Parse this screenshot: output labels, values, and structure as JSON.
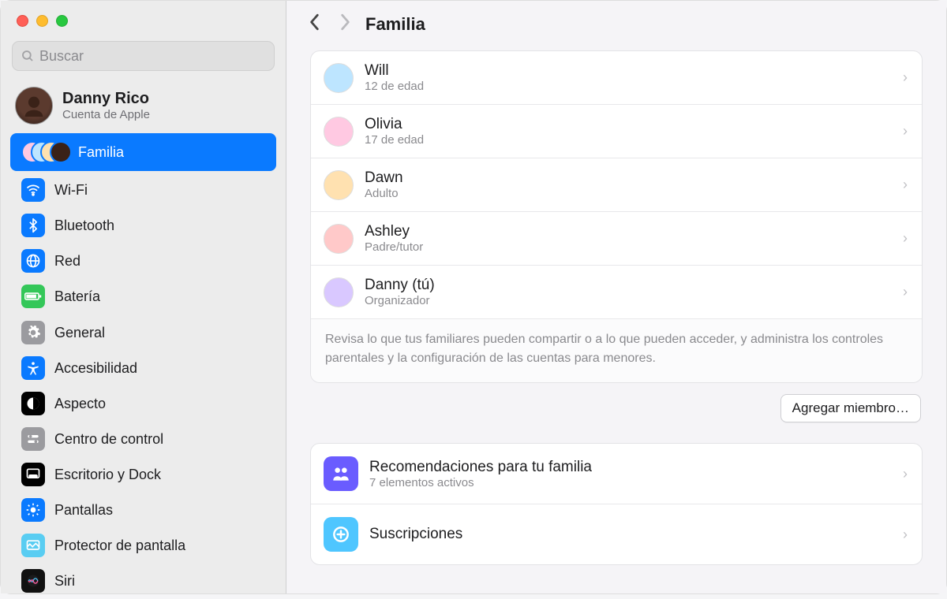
{
  "search": {
    "placeholder": "Buscar"
  },
  "account": {
    "name": "Danny Rico",
    "sub": "Cuenta de Apple"
  },
  "sidebar": {
    "active": {
      "label": "Familia"
    },
    "group1": [
      {
        "label": "Wi-Fi",
        "bg": "#0a7aff",
        "icon": "wifi"
      },
      {
        "label": "Bluetooth",
        "bg": "#0a7aff",
        "icon": "bt"
      },
      {
        "label": "Red",
        "bg": "#0a7aff",
        "icon": "globe"
      },
      {
        "label": "Batería",
        "bg": "#34c759",
        "icon": "batt"
      }
    ],
    "group2": [
      {
        "label": "General",
        "bg": "#9b9b9f",
        "icon": "gear"
      },
      {
        "label": "Accesibilidad",
        "bg": "#0a7aff",
        "icon": "acc"
      },
      {
        "label": "Aspecto",
        "bg": "#000",
        "icon": "appear"
      },
      {
        "label": "Centro de control",
        "bg": "#9b9b9f",
        "icon": "cc"
      },
      {
        "label": "Escritorio y Dock",
        "bg": "#000",
        "icon": "dock"
      },
      {
        "label": "Pantallas",
        "bg": "#0a7aff",
        "icon": "disp"
      },
      {
        "label": "Protector de pantalla",
        "bg": "#59cdf2",
        "icon": "ss"
      },
      {
        "label": "Siri",
        "bg": "#111",
        "icon": "siri"
      }
    ]
  },
  "header": {
    "title": "Familia"
  },
  "members": [
    {
      "name": "Will",
      "sub": "12 de edad",
      "bg": "#bde5ff"
    },
    {
      "name": "Olivia",
      "sub": "17 de edad",
      "bg": "#ffc9e2"
    },
    {
      "name": "Dawn",
      "sub": "Adulto",
      "bg": "#ffe1b0"
    },
    {
      "name": "Ashley",
      "sub": "Padre/tutor",
      "bg": "#ffc9c9"
    },
    {
      "name": "Danny (tú)",
      "sub": "Organizador",
      "bg": "#d9c8ff"
    }
  ],
  "help": "Revisa lo que tus familiares pueden compartir o a lo que pueden acceder, y administra los controles parentales y la configuración de las cuentas para menores.",
  "addButton": "Agregar miembro…",
  "options": [
    {
      "title": "Recomendaciones para tu familia",
      "sub": "7 elementos activos",
      "bg": "#6a5cff",
      "icon": "family"
    },
    {
      "title": "Suscripciones",
      "sub": "",
      "bg": "#4fc6ff",
      "icon": "subs"
    }
  ]
}
